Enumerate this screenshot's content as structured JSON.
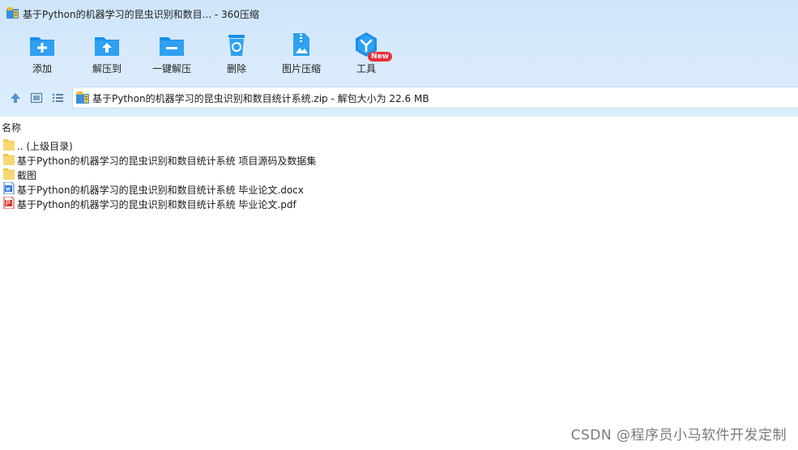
{
  "window": {
    "title": "基于Python的机器学习的昆虫识别和数目... - 360压缩"
  },
  "toolbar": {
    "items": [
      {
        "label": "添加",
        "icon": "folder-add-icon"
      },
      {
        "label": "解压到",
        "icon": "folder-extract-icon"
      },
      {
        "label": "一键解压",
        "icon": "folder-oneclick-icon"
      },
      {
        "label": "删除",
        "icon": "recycle-bin-icon"
      },
      {
        "label": "图片压缩",
        "icon": "image-compress-icon"
      },
      {
        "label": "工具",
        "icon": "tools-icon"
      }
    ],
    "new_badge": "New"
  },
  "navbar": {
    "path": "基于Python的机器学习的昆虫识别和数目统计系统.zip - 解包大小为 22.6 MB"
  },
  "list": {
    "column_header": "名称",
    "rows": [
      {
        "name": ".. (上级目录)",
        "type": "folder"
      },
      {
        "name": "基于Python的机器学习的昆虫识别和数目统计系统 项目源码及数据集",
        "type": "folder"
      },
      {
        "name": "截图",
        "type": "folder"
      },
      {
        "name": "基于Python的机器学习的昆虫识别和数目统计系统 毕业论文.docx",
        "type": "docx"
      },
      {
        "name": "基于Python的机器学习的昆虫识别和数目统计系统 毕业论文.pdf",
        "type": "pdf"
      }
    ]
  },
  "watermark": "CSDN @程序员小马软件开发定制",
  "colors": {
    "toolbar_bg": "#d6e9fc",
    "icon_blue": "#1a8ee8",
    "folder_yellow": "#f8d775",
    "badge_red": "#e8313a",
    "pdf_red": "#d9302b",
    "docx_blue": "#2a6fd6"
  }
}
